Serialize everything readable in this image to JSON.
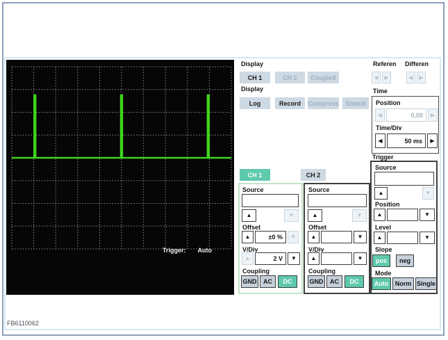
{
  "window": {
    "footer_id": "FB6110062"
  },
  "colors": {
    "accent_teal": "#5ec9ad",
    "panel_button": "#cdd9e3",
    "trace_green": "#3fd41c",
    "grid": "#898f96",
    "outer_border": "#8d9fba",
    "inner_border": "#d6e9f5"
  },
  "scope": {
    "status_label": "Trigger:",
    "status_value": "Auto",
    "grid": {
      "cols": 10,
      "rows": 8
    },
    "trace": {
      "baseline_div": 4,
      "spike_height_div": 2.75,
      "spike_positions_div": [
        1.05,
        5.0,
        8.95
      ]
    }
  },
  "display_channels": {
    "label": "Display",
    "ch1": "CH 1",
    "ch2": "CH 2",
    "coupled": "Coupled"
  },
  "display_modes": {
    "label": "Display",
    "log": "Log",
    "record": "Record",
    "compress": "Compress",
    "stimuli": "Stimuli"
  },
  "reference": {
    "label": "Referen"
  },
  "difference": {
    "label": "Differen"
  },
  "time": {
    "label": "Time",
    "position": {
      "label": "Position",
      "value": "0,00"
    },
    "timediv": {
      "label": "Time/Div",
      "value": "50 ms"
    }
  },
  "trigger": {
    "label": "Trigger",
    "source": {
      "label": "Source",
      "value": ""
    },
    "position": {
      "label": "Position",
      "value": ""
    },
    "level": {
      "label": "Level",
      "value": ""
    },
    "slope": {
      "label": "Slope",
      "pos": "pos",
      "neg": "neg"
    },
    "mode": {
      "label": "Mode",
      "auto": "Auto",
      "norm": "Norm",
      "single": "Single"
    }
  },
  "ch1": {
    "tab": "CH 1",
    "source": {
      "label": "Source",
      "value": ""
    },
    "offset": {
      "label": "Offset",
      "value": "±0 %"
    },
    "vdiv": {
      "label": "V/Div",
      "value": "2 V"
    },
    "coupling": {
      "label": "Coupling",
      "gnd": "GND",
      "ac": "AC",
      "dc": "DC"
    }
  },
  "ch2": {
    "tab": "CH 2",
    "source": {
      "label": "Source",
      "value": ""
    },
    "offset": {
      "label": "Offset",
      "value": ""
    },
    "vdiv": {
      "label": "V/Div",
      "value": ""
    },
    "coupling": {
      "label": "Coupling",
      "gnd": "GND",
      "ac": "AC",
      "dc": "DC"
    }
  },
  "glyphs": {
    "up": "▲",
    "down": "▼",
    "left": "◀",
    "right": "▶"
  }
}
